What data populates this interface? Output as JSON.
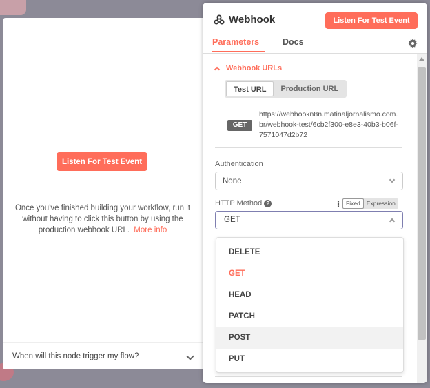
{
  "left_panel": {
    "listen_button": "Listen For Test Event",
    "info_text": "Once you've finished building your workflow, run it without having to click this button by using the production webhook URL.",
    "more_info_link": "More info",
    "trigger_question": "When will this node trigger my flow?"
  },
  "node_panel": {
    "title": "Webhook",
    "listen_button": "Listen For Test Event",
    "tabs": [
      "Parameters",
      "Docs"
    ],
    "active_tab": "Parameters"
  },
  "webhook_urls": {
    "section_title": "Webhook URLs",
    "toggle": [
      "Test URL",
      "Production URL"
    ],
    "active": "Test URL",
    "method_badge": "GET",
    "url": "https://webhookn8n.matinaljornalismo.com.br/webhook-test/6cb2f300-e8e3-40b3-b06f-7571047d2b72"
  },
  "authentication": {
    "label": "Authentication",
    "value": "None"
  },
  "http_method": {
    "label": "HTTP Method",
    "help_icon": "?",
    "value_mode": [
      "Fixed",
      "Expression"
    ],
    "active_mode": "Fixed",
    "value": "GET",
    "options": [
      "DELETE",
      "GET",
      "HEAD",
      "PATCH",
      "POST",
      "PUT"
    ],
    "selected": "GET",
    "hovered": "POST"
  },
  "colors": {
    "accent": "#ff6d5a",
    "canvas": "#8c8a97"
  }
}
